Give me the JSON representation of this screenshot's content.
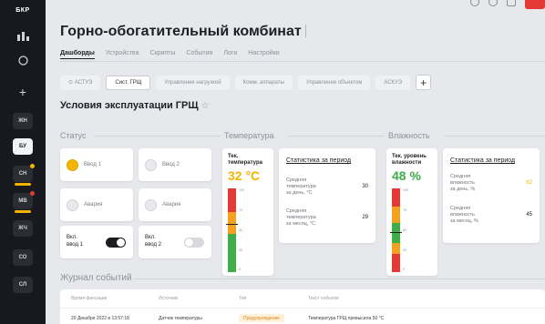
{
  "sidebar": {
    "logo": "БКР",
    "items": [
      {
        "label": "",
        "icon": "dashboard-icon"
      },
      {
        "label": "",
        "icon": "circle-icon"
      },
      {
        "label": "",
        "icon": "plus-icon"
      },
      {
        "label": "ЖН"
      },
      {
        "label": "БУ",
        "active": true
      },
      {
        "label": "СН",
        "dot": "#f4b400",
        "bar": "#f4b400"
      },
      {
        "label": "МВ",
        "dot": "#e53935",
        "bar": "#f4b400"
      },
      {
        "label": "ЖЧ"
      },
      {
        "label": "СО"
      },
      {
        "label": "СЛ"
      }
    ]
  },
  "header": {
    "title": "Горно-обогатительный комбинат",
    "tabs": [
      {
        "label": "Дашборды",
        "active": true
      },
      {
        "label": "Устройства"
      },
      {
        "label": "Скрипты"
      },
      {
        "label": "События"
      },
      {
        "label": "Логи"
      },
      {
        "label": "Настройки"
      }
    ]
  },
  "subtabs": [
    {
      "label": "⊙ АСТУЭ"
    },
    {
      "label": "Сист. ГРЩ",
      "active": true
    },
    {
      "label": "Управление нагрузкой"
    },
    {
      "label": "Комм. аппараты"
    },
    {
      "label": "Управление объектом"
    },
    {
      "label": "АСКУЭ"
    }
  ],
  "add_tab": "+",
  "section": {
    "title": "Условия эксплуатации ГРЩ",
    "star": "☆"
  },
  "groups": {
    "status": "Статус",
    "temperature": "Температура",
    "humidity": "Влажность"
  },
  "status_cards": [
    {
      "label": "Ввод 1",
      "on": true
    },
    {
      "label": "Ввод 2",
      "on": false
    },
    {
      "label": "Авария",
      "on": false
    },
    {
      "label": "Авария",
      "on": false
    }
  ],
  "toggles": [
    {
      "label_line1": "Вкл.",
      "label_line2": "ввод 1",
      "on": true
    },
    {
      "label_line1": "Вкл.",
      "label_line2": "ввод 2",
      "on": false
    }
  ],
  "temperature": {
    "gauge": {
      "title_line1": "Тек.",
      "title_line2": "температура",
      "value": "32 °C",
      "value_color": "#f4b400",
      "ticks": [
        "100",
        "75",
        "50",
        "25",
        "0"
      ],
      "level_percent": 58
    },
    "stats": {
      "link": "Статистика за период",
      "rows": [
        {
          "line1": "Средняя",
          "line2": "температура",
          "line3": "за день, °C",
          "value": "30"
        },
        {
          "line1": "Средняя",
          "line2": "температура",
          "line3": "за месяц, °C",
          "value": "29"
        }
      ]
    }
  },
  "humidity": {
    "gauge": {
      "title_line1": "Тек. уровень",
      "title_line2": "влажности",
      "value": "48 %",
      "value_color": "#3fae49",
      "ticks": [
        "100",
        "75",
        "50",
        "25",
        "0"
      ],
      "level_percent": 48
    },
    "stats": {
      "link": "Статистика за период",
      "rows": [
        {
          "line1": "Средняя",
          "line2": "влажность",
          "line3": "за день, %",
          "value": "62",
          "value_color": "#f4b400"
        },
        {
          "line1": "Средняя",
          "line2": "влажность",
          "line3": "за месяц, %",
          "value": "45"
        }
      ]
    }
  },
  "log": {
    "title": "Журнал событий",
    "columns": [
      "Время фиксации",
      "Источник",
      "Тип",
      "Текст события"
    ],
    "rows": [
      {
        "time": "20 Декабря 2022 в 13:57:18",
        "source": "Датчик температуры",
        "type": "Предупреждение",
        "text": "Температура ГРЩ превысила 50 °C"
      }
    ]
  },
  "colors": {
    "red": "#e53935",
    "orange": "#f4a21d",
    "green": "#3fae49",
    "accent_dark": "#1b1d21"
  }
}
